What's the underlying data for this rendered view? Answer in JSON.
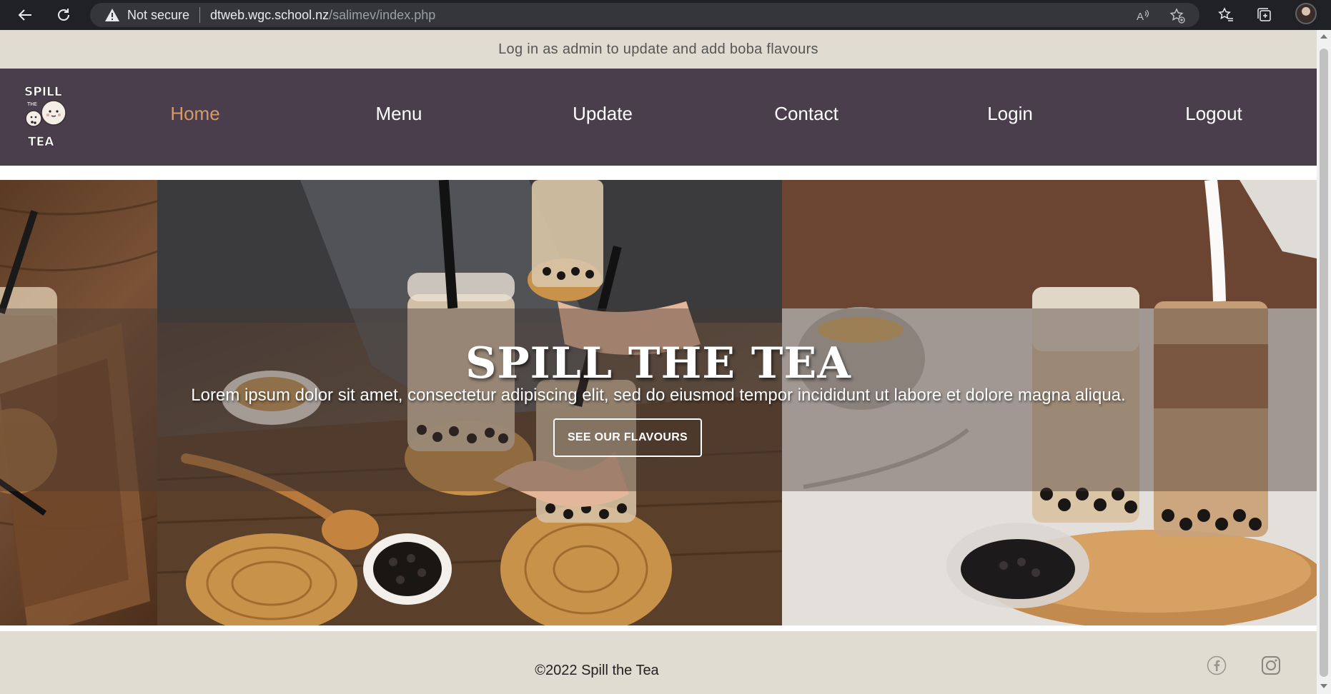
{
  "browser": {
    "not_secure_label": "Not secure",
    "url_host": "dtweb.wgc.school.nz",
    "url_path": "/salimev/index.php",
    "icons": [
      "back-arrow-icon",
      "reload-icon",
      "warning-icon",
      "read-aloud-icon",
      "favorite-add-icon",
      "favorites-icon",
      "collections-icon",
      "profile-avatar"
    ]
  },
  "notice": {
    "text": "Log in as admin to update and add boba flavours"
  },
  "logo": {
    "line1": "SPILL",
    "line2": "THE",
    "line3": "TEA"
  },
  "nav": {
    "items": [
      {
        "label": "Home",
        "active": true
      },
      {
        "label": "Menu",
        "active": false
      },
      {
        "label": "Update",
        "active": false
      },
      {
        "label": "Contact",
        "active": false
      },
      {
        "label": "Login",
        "active": false
      },
      {
        "label": "Logout",
        "active": false
      }
    ]
  },
  "hero": {
    "title": "SPILL THE TEA",
    "subtitle": "Lorem ipsum dolor sit amet, consectetur adipiscing elit, sed do eiusmod tempor incididunt ut labore et dolore magna aliqua.",
    "button_label": "SEE OUR FLAVOURS"
  },
  "footer": {
    "copyright": "©2022 Spill the Tea",
    "social": [
      "facebook-icon",
      "instagram-icon"
    ]
  },
  "colors": {
    "navbar_bg": "#4a3e4c",
    "nav_active": "#d39a6a",
    "notice_bg": "#e0dcd2",
    "footer_bg": "#e0dcd2"
  }
}
